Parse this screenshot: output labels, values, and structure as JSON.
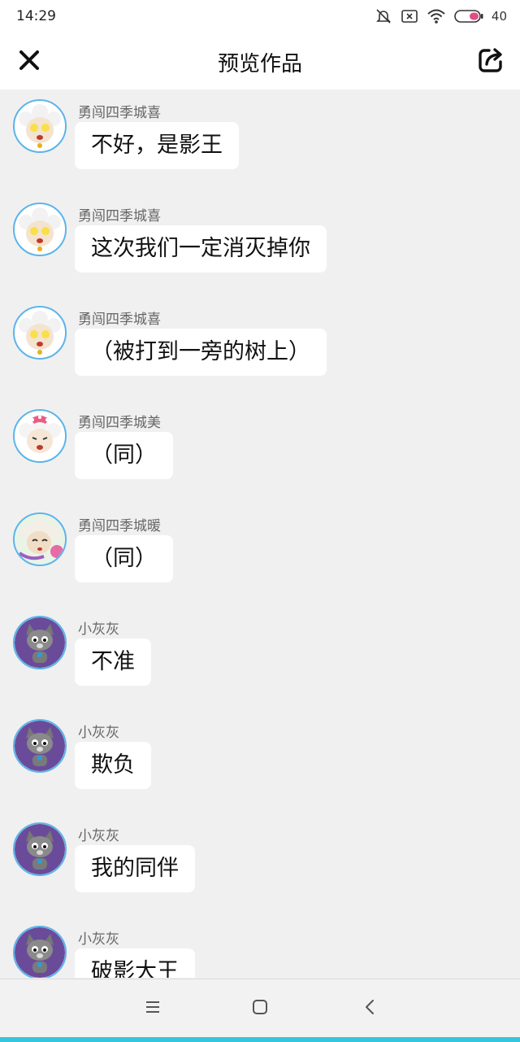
{
  "status_bar": {
    "time": "14:29",
    "battery": "40",
    "icons": [
      "bell-off-icon",
      "notification-x-icon",
      "wifi-icon",
      "battery-icon"
    ]
  },
  "header": {
    "title": "预览作品",
    "close_icon": "close-icon",
    "share_icon": "share-icon"
  },
  "messages": [
    {
      "sender": "勇闯四季城喜",
      "text": "不好，是影王",
      "avatar": "pleasant-goat"
    },
    {
      "sender": "勇闯四季城喜",
      "text": "这次我们一定消灭掉你",
      "avatar": "pleasant-goat"
    },
    {
      "sender": "勇闯四季城喜",
      "text": "（被打到一旁的树上）",
      "avatar": "pleasant-goat"
    },
    {
      "sender": "勇闯四季城美",
      "text": "（同）",
      "avatar": "pretty-goat"
    },
    {
      "sender": "勇闯四季城暖",
      "text": "（同）",
      "avatar": "warm-goat"
    },
    {
      "sender": "小灰灰",
      "text": "不准",
      "avatar": "little-wolf"
    },
    {
      "sender": "小灰灰",
      "text": "欺负",
      "avatar": "little-wolf"
    },
    {
      "sender": "小灰灰",
      "text": "我的同伴",
      "avatar": "little-wolf"
    },
    {
      "sender": "小灰灰",
      "text": "破影大王",
      "avatar": "little-wolf"
    }
  ],
  "system_nav": {
    "icons": [
      "menu-icon",
      "home-icon",
      "back-icon"
    ]
  },
  "colors": {
    "avatar_ring": "#5ab4ea",
    "accent": "#34c6dc",
    "background": "#f0f0f0"
  }
}
